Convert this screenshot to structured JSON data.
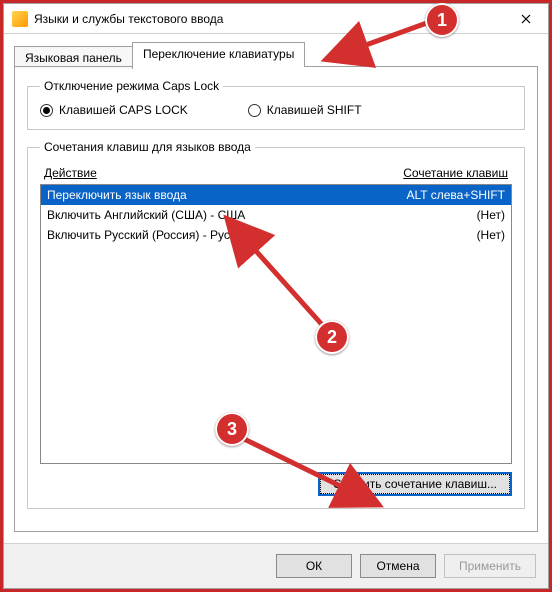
{
  "window": {
    "title": "Языки и службы текстового ввода",
    "close_tooltip": "Закрыть"
  },
  "tabs": {
    "panel_label": "Языковая панель",
    "switch_label": "Переключение клавиатуры"
  },
  "capslock": {
    "legend": "Отключение режима Caps Lock",
    "opt_caps": "Клавишей CAPS LOCK",
    "opt_shift": "Клавишей SHIFT"
  },
  "keys": {
    "legend": "Сочетания клавиш для языков ввода",
    "col_action": "Действие",
    "col_combo": "Сочетание клавиш",
    "rows": [
      {
        "action": "Переключить язык ввода",
        "combo": "ALT слева+SHIFT",
        "selected": true
      },
      {
        "action": "Включить Английский (США) - США",
        "combo": "(Нет)",
        "selected": false
      },
      {
        "action": "Включить Русский (Россия) - Русская",
        "combo": "(Нет)",
        "selected": false
      }
    ],
    "change_btn": "Сменить сочетание клавиш..."
  },
  "dialog_buttons": {
    "ok": "ОК",
    "cancel": "Отмена",
    "apply": "Применить"
  },
  "annotations": {
    "n1": "1",
    "n2": "2",
    "n3": "3"
  }
}
